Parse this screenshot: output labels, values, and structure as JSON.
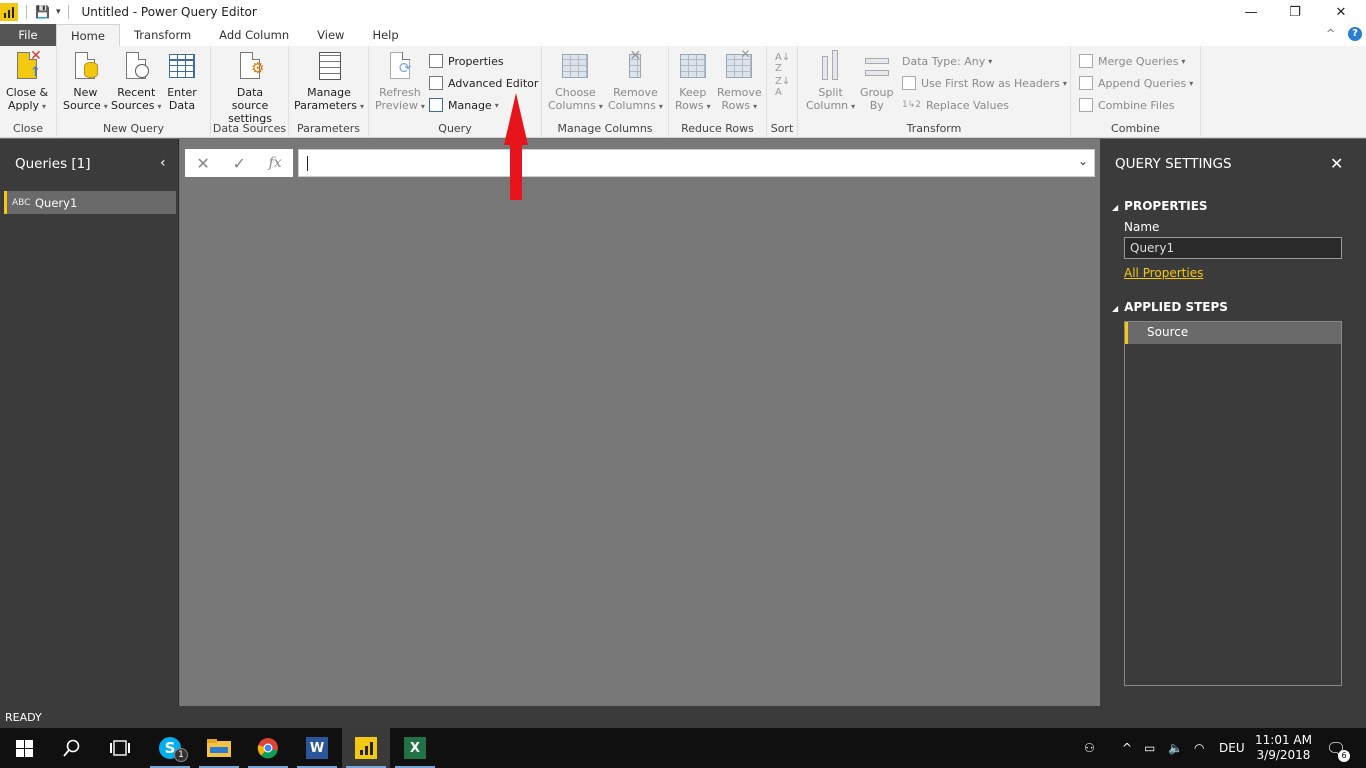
{
  "window": {
    "title": "Untitled - Power Query Editor",
    "minimize": "—",
    "restore": "❐",
    "close": "✕"
  },
  "tabs": [
    "File",
    "Home",
    "Transform",
    "Add Column",
    "View",
    "Help"
  ],
  "ribbon_extras": {
    "collapse": "^",
    "help": "?"
  },
  "ribbon": {
    "close": {
      "btn1": "Close &",
      "btn2": "Apply",
      "label": "Close"
    },
    "new_query": {
      "new_source_1": "New",
      "new_source_2": "Source",
      "recent_1": "Recent",
      "recent_2": "Sources",
      "enter_1": "Enter",
      "enter_2": "Data",
      "label": "New Query"
    },
    "data_sources": {
      "btn1": "Data source",
      "btn2": "settings",
      "label": "Data Sources"
    },
    "parameters": {
      "btn1": "Manage",
      "btn2": "Parameters",
      "label": "Parameters"
    },
    "query": {
      "refresh_1": "Refresh",
      "refresh_2": "Preview",
      "properties": "Properties",
      "advanced_editor": "Advanced Editor",
      "manage": "Manage",
      "label": "Query"
    },
    "manage_columns": {
      "choose_1": "Choose",
      "choose_2": "Columns",
      "remove_1": "Remove",
      "remove_2": "Columns",
      "label": "Manage Columns"
    },
    "reduce_rows": {
      "keep_1": "Keep",
      "keep_2": "Rows",
      "remove_1": "Remove",
      "remove_2": "Rows",
      "label": "Reduce Rows"
    },
    "sort": {
      "label": "Sort"
    },
    "transform": {
      "split_1": "Split",
      "split_2": "Column",
      "group_1": "Group",
      "group_2": "By",
      "data_type": "Data Type: Any",
      "first_row": "Use First Row as Headers",
      "replace": "Replace Values",
      "label": "Transform"
    },
    "combine": {
      "merge": "Merge Queries",
      "append": "Append Queries",
      "combine_files": "Combine Files",
      "label": "Combine"
    }
  },
  "queries_panel": {
    "header": "Queries [1]",
    "items": [
      {
        "type_icon": "ABC",
        "name": "Query1"
      }
    ]
  },
  "formula_bar": {
    "cancel": "✕",
    "commit": "✓",
    "fx": "fx",
    "value": ""
  },
  "query_settings": {
    "title": "QUERY SETTINGS",
    "properties_header": "PROPERTIES",
    "name_label": "Name",
    "name_value": "Query1",
    "all_properties": "All Properties",
    "applied_steps_header": "APPLIED STEPS",
    "steps": [
      "Source"
    ]
  },
  "status": "READY",
  "taskbar": {
    "skype_badge": "1",
    "tray_lang": "DEU",
    "time": "11:01 AM",
    "date": "3/9/2018",
    "notifications": "6"
  },
  "colors": {
    "accent": "#f2c811",
    "annotation_arrow": "#e8141c"
  }
}
